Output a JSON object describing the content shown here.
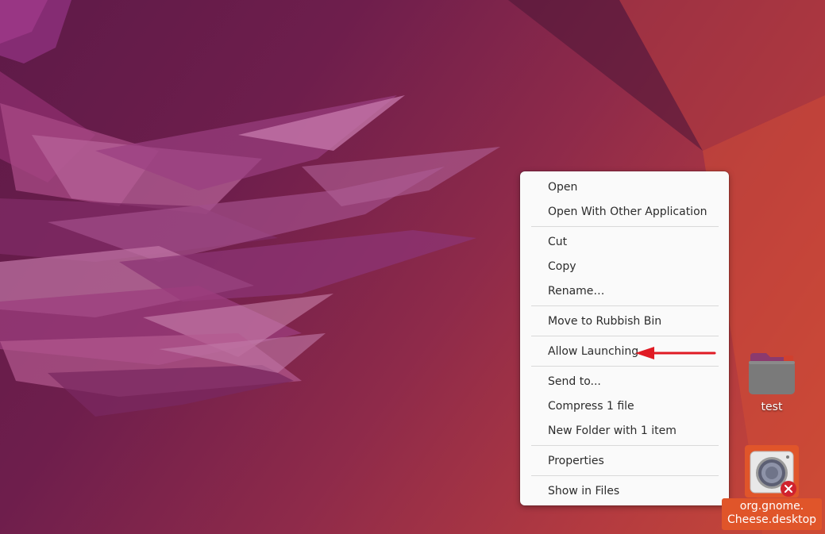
{
  "context_menu": {
    "items": [
      {
        "label": "Open"
      },
      {
        "label": "Open With Other Application"
      },
      {
        "label": "Cut"
      },
      {
        "label": "Copy"
      },
      {
        "label": "Rename…"
      },
      {
        "label": "Move to Rubbish Bin"
      },
      {
        "label": "Allow Launching"
      },
      {
        "label": "Send to..."
      },
      {
        "label": "Compress 1 file"
      },
      {
        "label": "New Folder with 1 item"
      },
      {
        "label": "Properties"
      },
      {
        "label": "Show in Files"
      }
    ]
  },
  "desktop_icons": {
    "folder": {
      "label": "test",
      "icon": "folder-icon"
    },
    "launcher": {
      "label_line1": "org.gnome.",
      "label_line2": "Cheese.desktop",
      "icon": "camera-icon",
      "badge": "untrusted-x-icon"
    }
  },
  "colors": {
    "accent": "#e0552a",
    "arrow": "#e01b24",
    "menu_bg": "#fafafa"
  }
}
